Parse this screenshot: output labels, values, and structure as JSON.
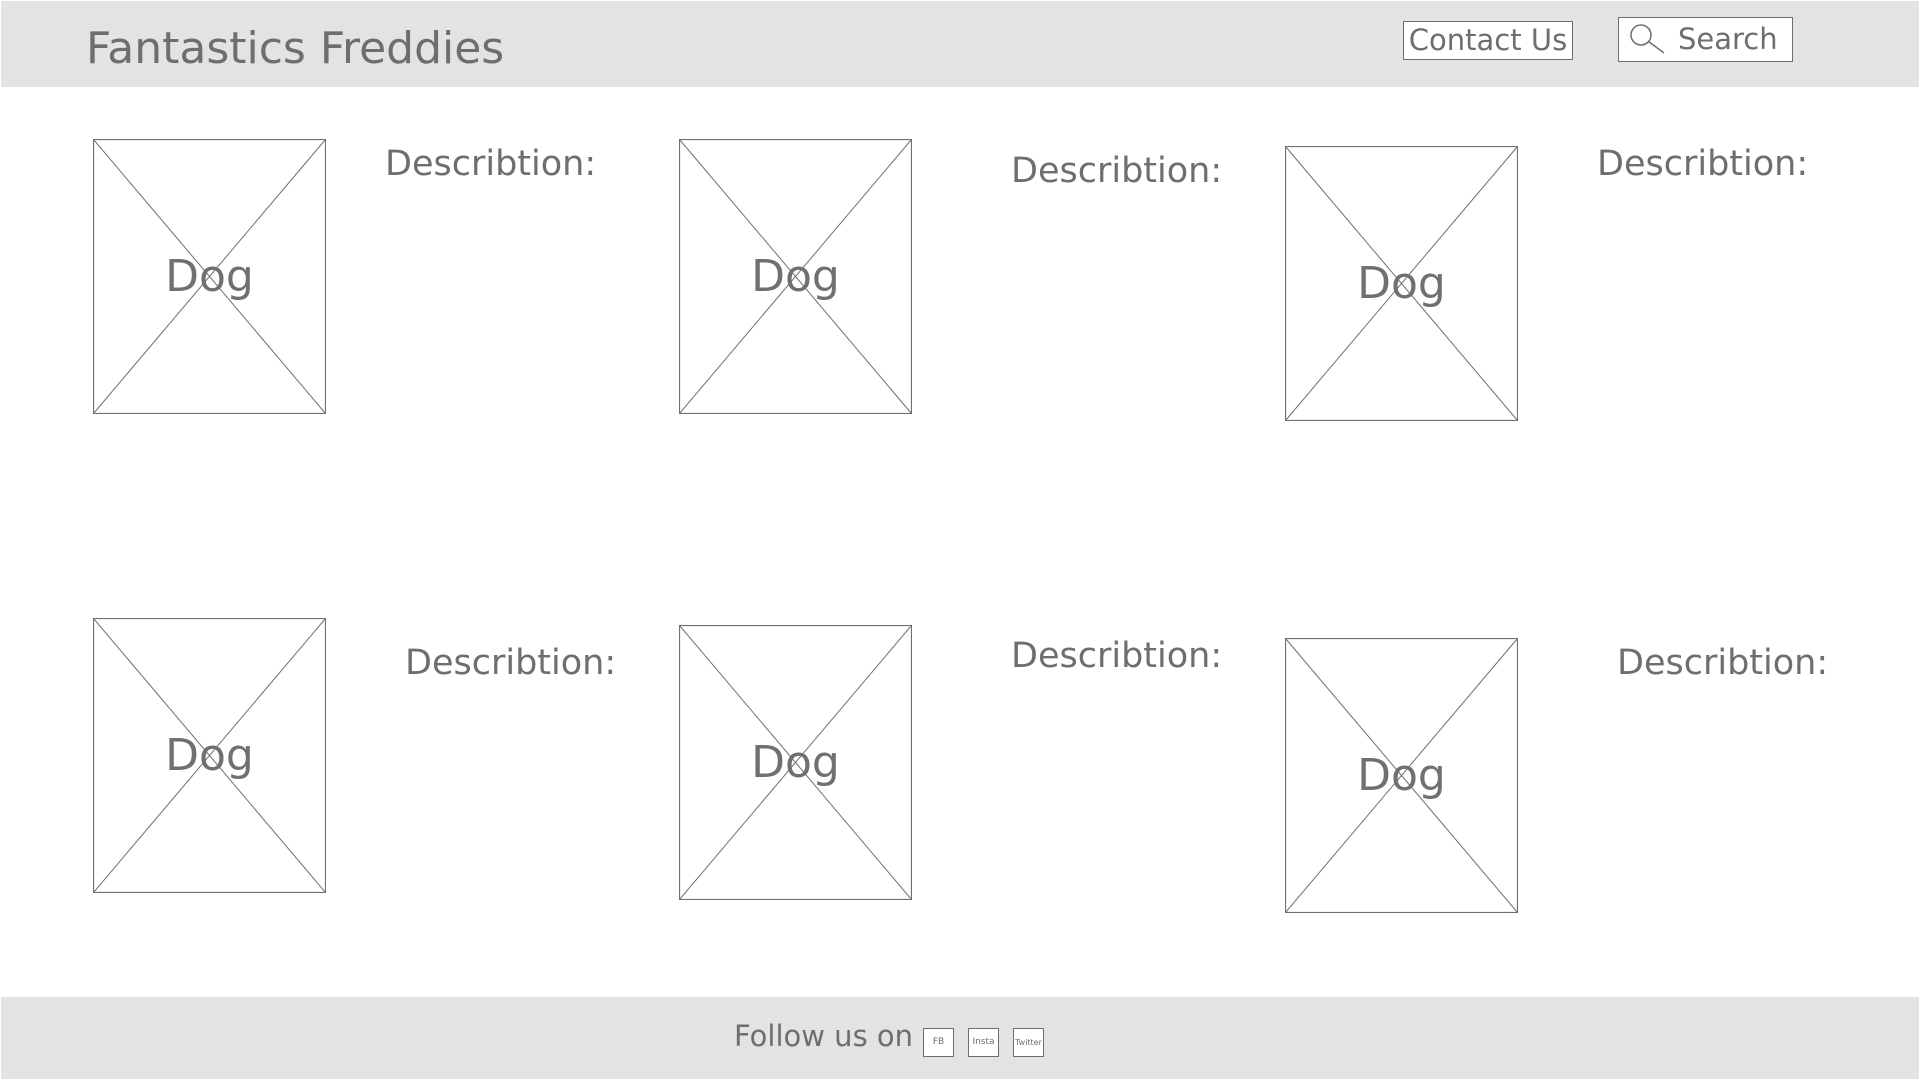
{
  "header": {
    "title": "Fantastics Freddies",
    "contact_label": "Contact Us",
    "search_label": "Search"
  },
  "cards": [
    {
      "image_label": "Dog",
      "description_label": "Describtion:"
    },
    {
      "image_label": "Dog",
      "description_label": "Describtion:"
    },
    {
      "image_label": "Dog",
      "description_label": "Describtion:"
    },
    {
      "image_label": "Dog",
      "description_label": "Describtion:"
    },
    {
      "image_label": "Dog",
      "description_label": "Describtion:"
    },
    {
      "image_label": "Dog",
      "description_label": "Describtion:"
    }
  ],
  "footer": {
    "follow_text": "Follow us on",
    "social": [
      {
        "label": "FB"
      },
      {
        "label": "Insta"
      },
      {
        "label": "Twitter"
      }
    ]
  },
  "colors": {
    "bar_background": "#e3e3e3",
    "text": "#6e6e6e",
    "outline": "#6e6e6e",
    "page_background": "#ffffff"
  },
  "icons": {
    "search": "search-icon",
    "image_placeholder": "image-placeholder-icon"
  }
}
